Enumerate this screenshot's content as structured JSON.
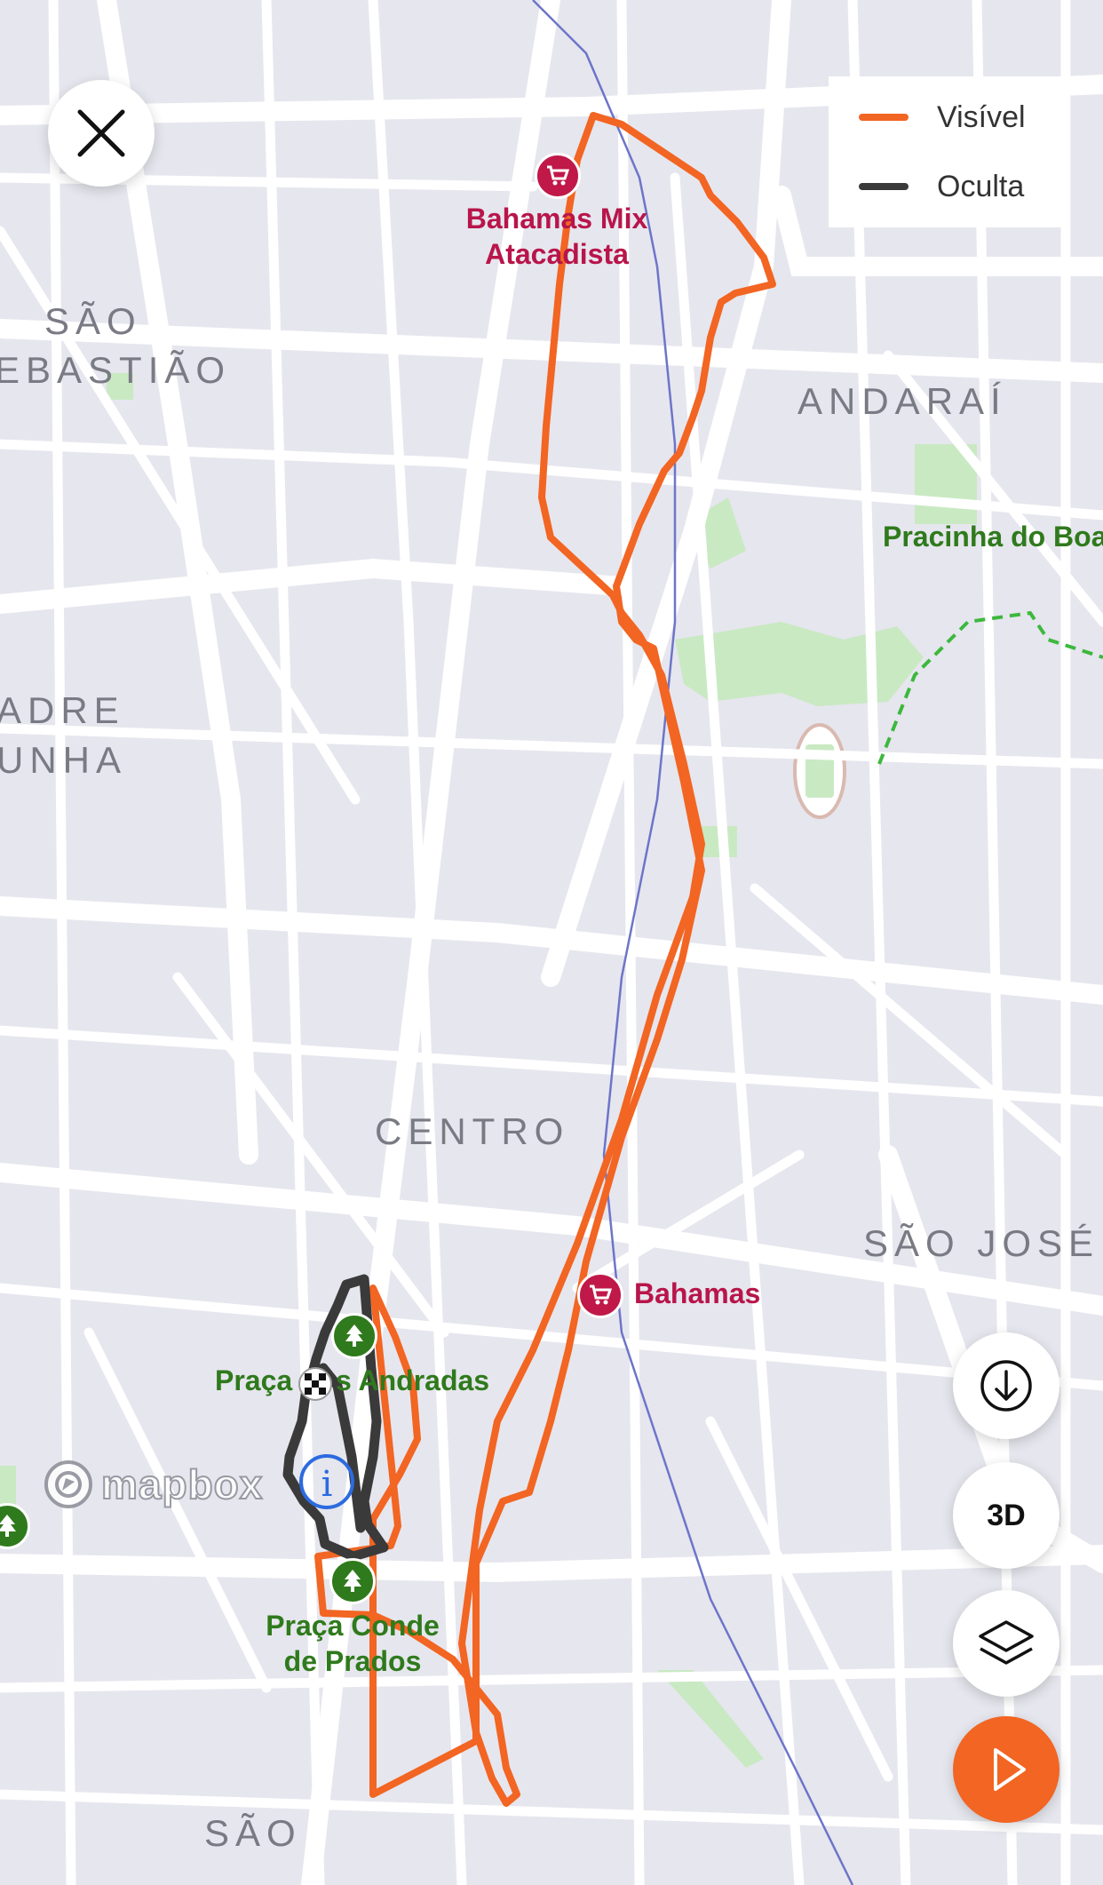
{
  "legend": {
    "visible_label": "Visível",
    "hidden_label": "Oculta",
    "visible_color": "#f26522",
    "hidden_color": "#3a3a3a"
  },
  "districts": {
    "sao_sebastiao_1": "SÃO",
    "sao_sebastiao_2": "EBASTIÃO",
    "andarai": "ANDARAÍ",
    "padre_1": "ADRE",
    "padre_2": "UNHA",
    "centro": "CENTRO",
    "sao_jose": "SÃO JOSÉ",
    "sao_bottom": "SÃO"
  },
  "pois": {
    "bahamas_mix_1": "Bahamas Mix",
    "bahamas_mix_2": "Atacadista",
    "bahamas": "Bahamas",
    "pracinha": "Pracinha do Boa",
    "praca_andradas_left": "Praça",
    "praca_andradas_right": "s Andradas",
    "praca_conde_1": "Praça Conde",
    "praca_conde_2": "de Prados"
  },
  "attribution": {
    "brand": "mapbox"
  },
  "controls": {
    "close_icon": "close-icon",
    "download_icon": "download-icon",
    "three_d_label": "3D",
    "layers_icon": "layers-icon",
    "play_icon": "play-icon"
  },
  "colors": {
    "route_visible": "#f26522",
    "route_hidden": "#3a3a3a",
    "park": "#c6e8bf",
    "shop": "#c01848",
    "play_button": "#f26522"
  }
}
